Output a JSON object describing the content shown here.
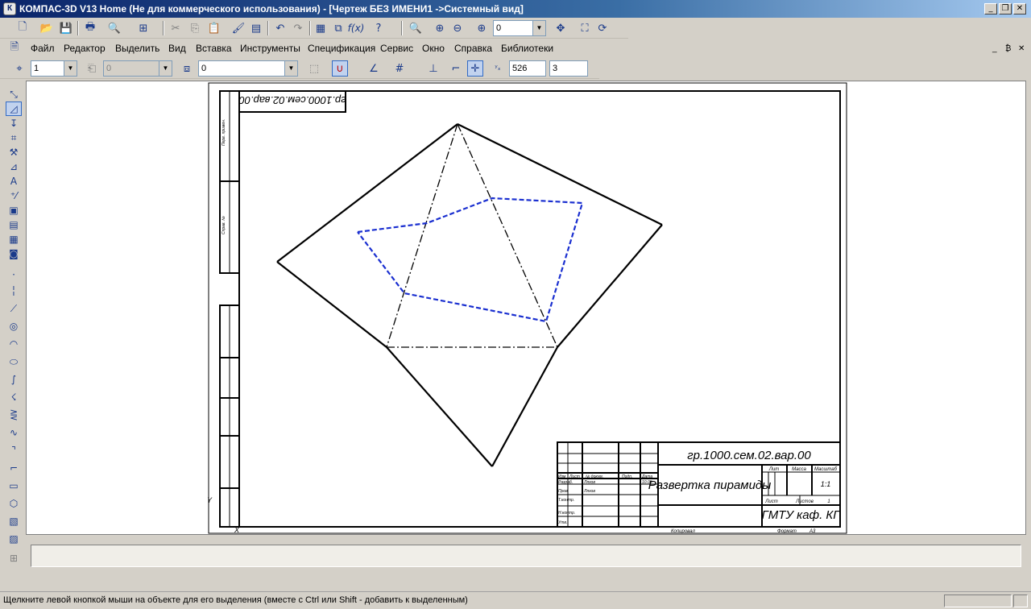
{
  "window": {
    "app_icon": "К",
    "title": "КОМПАС-3D V13 Home (Не для коммерческого использования) - [Чертеж БЕЗ ИМЕНИ1 ->Системный вид]",
    "minimize": "_",
    "restore": "❐",
    "close": "✕"
  },
  "menu": {
    "items": [
      {
        "label": "Файл"
      },
      {
        "label": "Редактор"
      },
      {
        "label": "Выделить"
      },
      {
        "label": "Вид"
      },
      {
        "label": "Вставка"
      },
      {
        "label": "Инструменты"
      },
      {
        "label": "Спецификация"
      },
      {
        "label": "Сервис"
      },
      {
        "label": "Окно"
      },
      {
        "label": "Справка"
      },
      {
        "label": "Библиотеки"
      }
    ],
    "doc_controls": [
      "_",
      "₿",
      "✕"
    ]
  },
  "standard_toolbar": {
    "zoom_value": "0"
  },
  "current_state_toolbar": {
    "step_value": "1",
    "layer_value": "0",
    "style_value": "0",
    "x_coord": "526",
    "y_coord": "3"
  },
  "drawing": {
    "stamp_code": "гр.1000.сем.02.вар.00",
    "stamp_code_rotated": "гр.1000.сем.02.вар.00",
    "title": "Развертка пирамиды",
    "organization": "ГМТУ каф. КГ",
    "scale": "1:1",
    "sheet_label": "Лист",
    "sheets_label": "Листов",
    "sheets_count": "1",
    "lit_label": "Лит",
    "mass_label": "Масса",
    "scale_label": "Масштаб",
    "rows": {
      "izm": "Изм",
      "list": "Лист",
      "doc": "№ докум.",
      "podp": "Подп.",
      "data": "Дата",
      "razrab": "Разраб.",
      "prov": "Пров.",
      "tkontr": "Т.контр.",
      "nkontr": "Н.контр.",
      "utv": "Утв.",
      "name1": "Ляхов",
      "name2": "Ляхов",
      "date1": "10.05"
    },
    "copied": "Копировал",
    "format": "Формат",
    "format_value": "А3",
    "axis_y": "Y",
    "axis_x": "X"
  },
  "colors": {
    "blue_line": "#1a2fd0",
    "black_line": "#000000"
  },
  "status": {
    "hint": "Щелкните левой кнопкой мыши на объекте для его выделения (вместе с Ctrl или Shift - добавить к выделенным)"
  }
}
